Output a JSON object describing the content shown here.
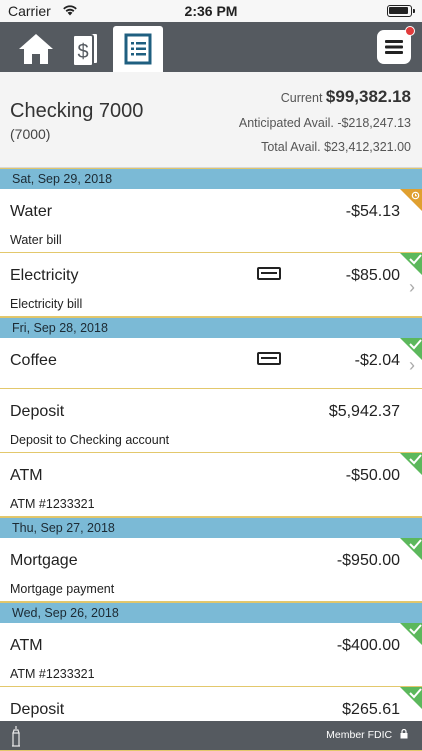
{
  "status": {
    "carrier": "Carrier",
    "time": "2:36 PM"
  },
  "nav": {
    "tabs": [
      "home-icon",
      "money-icon",
      "register-icon"
    ],
    "menu": "menu-icon"
  },
  "account": {
    "name": "Checking 7000",
    "number": "(7000)",
    "current_label": "Current",
    "current_value": "$99,382.18",
    "anticipated": "Anticipated Avail. -$218,247.13",
    "total": "Total Avail. $23,412,321.00"
  },
  "groups": [
    {
      "date": "Sat, Sep 29, 2018",
      "items": [
        {
          "name": "Water",
          "amount": "-$54.13",
          "memo": "Water bill",
          "status": "pending"
        },
        {
          "name": "Electricity",
          "amount": "-$85.00",
          "memo": "Electricity bill",
          "status": "cleared",
          "card": true,
          "chevron": true
        }
      ]
    },
    {
      "date": "Fri, Sep 28, 2018",
      "items": [
        {
          "name": "Coffee",
          "amount": "-$2.04",
          "memo": "",
          "status": "cleared",
          "card": true,
          "chevron": true
        },
        {
          "name": "Deposit",
          "amount": "$5,942.37",
          "memo": "Deposit to Checking account",
          "status": ""
        },
        {
          "name": "ATM",
          "amount": "-$50.00",
          "memo": "ATM #1233321",
          "status": "cleared"
        }
      ]
    },
    {
      "date": "Thu, Sep 27, 2018",
      "items": [
        {
          "name": "Mortgage",
          "amount": "-$950.00",
          "memo": "Mortgage payment",
          "status": "cleared"
        }
      ]
    },
    {
      "date": "Wed, Sep 26, 2018",
      "items": [
        {
          "name": "ATM",
          "amount": "-$400.00",
          "memo": "ATM #1233321",
          "status": "cleared"
        },
        {
          "name": "Deposit",
          "amount": "$265.61",
          "memo": "",
          "status": "cleared"
        }
      ]
    }
  ],
  "footer": {
    "fdic": "Member FDIC"
  },
  "colors": {
    "nav": "#555a60",
    "date_header": "#7bbad6",
    "cleared": "#5cb85c",
    "pending": "#e0a030"
  }
}
